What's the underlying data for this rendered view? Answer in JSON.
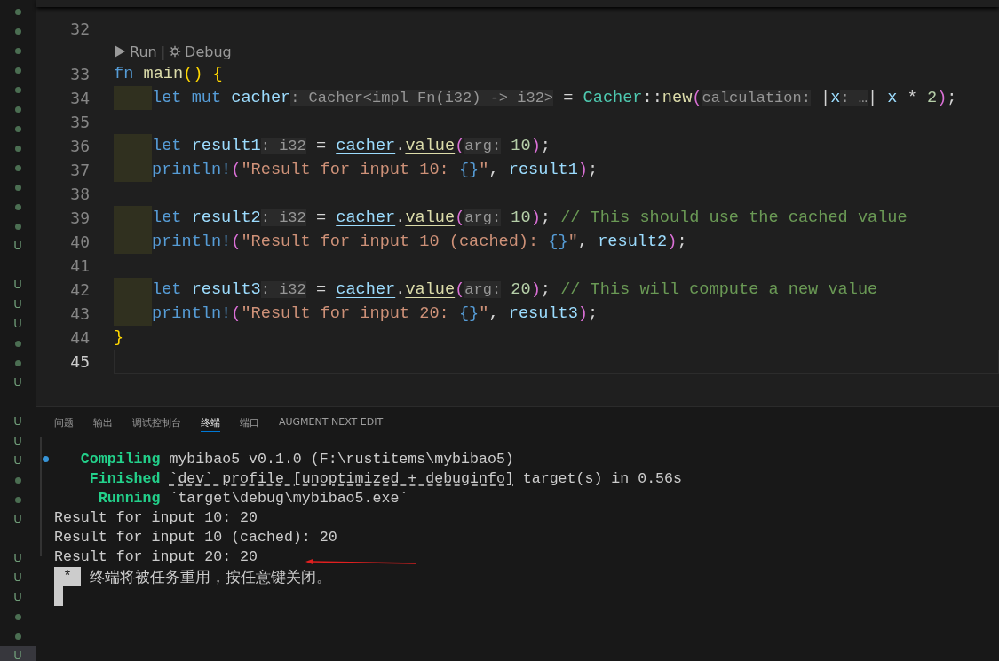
{
  "gutter_markers": [
    {
      "kind": "dot",
      "selected": false
    },
    {
      "kind": "dot",
      "selected": false
    },
    {
      "kind": "dot",
      "selected": false
    },
    {
      "kind": "dot",
      "selected": false
    },
    {
      "kind": "dot",
      "selected": false
    },
    {
      "kind": "dot",
      "selected": false
    },
    {
      "kind": "dot",
      "selected": false
    },
    {
      "kind": "dot",
      "selected": false
    },
    {
      "kind": "dot",
      "selected": false
    },
    {
      "kind": "dot",
      "selected": false
    },
    {
      "kind": "dot",
      "selected": false
    },
    {
      "kind": "dot",
      "selected": false
    },
    {
      "kind": "letter",
      "text": "U",
      "selected": false
    },
    {
      "kind": "gap",
      "selected": false
    },
    {
      "kind": "letter",
      "text": "U",
      "selected": false
    },
    {
      "kind": "letter",
      "text": "U",
      "selected": false
    },
    {
      "kind": "letter",
      "text": "U",
      "selected": false
    },
    {
      "kind": "dot",
      "selected": false
    },
    {
      "kind": "dot",
      "selected": false
    },
    {
      "kind": "letter",
      "text": "U",
      "selected": false
    },
    {
      "kind": "gap",
      "selected": false
    },
    {
      "kind": "letter",
      "text": "U",
      "selected": false
    },
    {
      "kind": "letter",
      "text": "U",
      "selected": false
    },
    {
      "kind": "letter",
      "text": "U",
      "selected": false
    },
    {
      "kind": "dot",
      "selected": false
    },
    {
      "kind": "dot",
      "selected": false
    },
    {
      "kind": "letter",
      "text": "U",
      "selected": false
    },
    {
      "kind": "gap",
      "selected": false
    },
    {
      "kind": "letter",
      "text": "U",
      "selected": false
    },
    {
      "kind": "letter",
      "text": "U",
      "selected": false
    },
    {
      "kind": "letter",
      "text": "U",
      "selected": false
    },
    {
      "kind": "dot",
      "selected": false
    },
    {
      "kind": "dot",
      "selected": false
    },
    {
      "kind": "letter",
      "text": "U",
      "selected": true
    }
  ],
  "editor": {
    "lines": [
      {
        "kind": "code",
        "number": "32",
        "indent": false,
        "current": false
      },
      {
        "kind": "codelens",
        "run": "Run",
        "separator": "|",
        "debug": "Debug"
      },
      {
        "kind": "code",
        "number": "33",
        "indent": false,
        "current": false,
        "tokens": [
          {
            "kind": "kw",
            "text": "fn "
          },
          {
            "kind": "fn",
            "text": "main"
          },
          {
            "kind": "bracket1",
            "text": "() {"
          }
        ]
      },
      {
        "kind": "code",
        "number": "34",
        "indent": true,
        "current": false,
        "tokens": [
          {
            "kind": "kw",
            "text": "let mut "
          },
          {
            "kind": "mutvar",
            "text": "cacher"
          },
          {
            "kind": "inlay",
            "text": ": Cacher<impl Fn(i32) -> i32>"
          },
          {
            "kind": "plain",
            "text": " = "
          },
          {
            "kind": "type",
            "text": "Cacher"
          },
          {
            "kind": "plain",
            "text": "::"
          },
          {
            "kind": "fn",
            "text": "new"
          },
          {
            "kind": "bracket2",
            "text": "("
          },
          {
            "kind": "inlay",
            "text": "calculation:"
          },
          {
            "kind": "plain",
            "text": " |"
          },
          {
            "kind": "var",
            "text": "x"
          },
          {
            "kind": "inlay",
            "text": ": …"
          },
          {
            "kind": "plain",
            "text": "| "
          },
          {
            "kind": "var",
            "text": "x"
          },
          {
            "kind": "plain",
            "text": " * "
          },
          {
            "kind": "num",
            "text": "2"
          },
          {
            "kind": "bracket2",
            "text": ")"
          },
          {
            "kind": "plain",
            "text": ";"
          }
        ]
      },
      {
        "kind": "code",
        "number": "35",
        "indent": false,
        "current": false
      },
      {
        "kind": "code",
        "number": "36",
        "indent": true,
        "current": false,
        "tokens": [
          {
            "kind": "kw",
            "text": "let "
          },
          {
            "kind": "var",
            "text": "result1"
          },
          {
            "kind": "inlay",
            "text": ": i32"
          },
          {
            "kind": "plain",
            "text": " = "
          },
          {
            "kind": "mutvar",
            "text": "cacher"
          },
          {
            "kind": "plain",
            "text": "."
          },
          {
            "kind": "mutfn",
            "text": "value"
          },
          {
            "kind": "bracket2",
            "text": "("
          },
          {
            "kind": "inlay",
            "text": "arg:"
          },
          {
            "kind": "num",
            "text": " 10"
          },
          {
            "kind": "bracket2",
            "text": ")"
          },
          {
            "kind": "plain",
            "text": ";"
          }
        ]
      },
      {
        "kind": "code",
        "number": "37",
        "indent": true,
        "current": false,
        "tokens": [
          {
            "kind": "macro",
            "text": "println!"
          },
          {
            "kind": "bracket2",
            "text": "("
          },
          {
            "kind": "str",
            "text": "\"Result for input 10: "
          },
          {
            "kind": "fmt",
            "text": "{}"
          },
          {
            "kind": "str",
            "text": "\""
          },
          {
            "kind": "plain",
            "text": ", "
          },
          {
            "kind": "var",
            "text": "result1"
          },
          {
            "kind": "bracket2",
            "text": ")"
          },
          {
            "kind": "plain",
            "text": ";"
          }
        ]
      },
      {
        "kind": "code",
        "number": "38",
        "indent": false,
        "current": false
      },
      {
        "kind": "code",
        "number": "39",
        "indent": true,
        "current": false,
        "tokens": [
          {
            "kind": "kw",
            "text": "let "
          },
          {
            "kind": "var",
            "text": "result2"
          },
          {
            "kind": "inlay",
            "text": ": i32"
          },
          {
            "kind": "plain",
            "text": " = "
          },
          {
            "kind": "mutvar",
            "text": "cacher"
          },
          {
            "kind": "plain",
            "text": "."
          },
          {
            "kind": "mutfn",
            "text": "value"
          },
          {
            "kind": "bracket2",
            "text": "("
          },
          {
            "kind": "inlay",
            "text": "arg:"
          },
          {
            "kind": "num",
            "text": " 10"
          },
          {
            "kind": "bracket2",
            "text": ")"
          },
          {
            "kind": "plain",
            "text": ";"
          },
          {
            "kind": "comment",
            "text": " // This should use the cached value"
          }
        ]
      },
      {
        "kind": "code",
        "number": "40",
        "indent": true,
        "current": false,
        "tokens": [
          {
            "kind": "macro",
            "text": "println!"
          },
          {
            "kind": "bracket2",
            "text": "("
          },
          {
            "kind": "str",
            "text": "\"Result for input 10 (cached): "
          },
          {
            "kind": "fmt",
            "text": "{}"
          },
          {
            "kind": "str",
            "text": "\""
          },
          {
            "kind": "plain",
            "text": ", "
          },
          {
            "kind": "var",
            "text": "result2"
          },
          {
            "kind": "bracket2",
            "text": ")"
          },
          {
            "kind": "plain",
            "text": ";"
          }
        ]
      },
      {
        "kind": "code",
        "number": "41",
        "indent": false,
        "current": false
      },
      {
        "kind": "code",
        "number": "42",
        "indent": true,
        "current": false,
        "tokens": [
          {
            "kind": "kw",
            "text": "let "
          },
          {
            "kind": "var",
            "text": "result3"
          },
          {
            "kind": "inlay",
            "text": ": i32"
          },
          {
            "kind": "plain",
            "text": " = "
          },
          {
            "kind": "mutvar",
            "text": "cacher"
          },
          {
            "kind": "plain",
            "text": "."
          },
          {
            "kind": "mutfn",
            "text": "value"
          },
          {
            "kind": "bracket2",
            "text": "("
          },
          {
            "kind": "inlay",
            "text": "arg:"
          },
          {
            "kind": "num",
            "text": " 20"
          },
          {
            "kind": "bracket2",
            "text": ")"
          },
          {
            "kind": "plain",
            "text": ";"
          },
          {
            "kind": "comment",
            "text": " // This will compute a new value"
          }
        ]
      },
      {
        "kind": "code",
        "number": "43",
        "indent": true,
        "current": false,
        "tokens": [
          {
            "kind": "macro",
            "text": "println!"
          },
          {
            "kind": "bracket2",
            "text": "("
          },
          {
            "kind": "str",
            "text": "\"Result for input 20: "
          },
          {
            "kind": "fmt",
            "text": "{}"
          },
          {
            "kind": "str",
            "text": "\""
          },
          {
            "kind": "plain",
            "text": ", "
          },
          {
            "kind": "var",
            "text": "result3"
          },
          {
            "kind": "bracket2",
            "text": ")"
          },
          {
            "kind": "plain",
            "text": ";"
          }
        ]
      },
      {
        "kind": "code",
        "number": "44",
        "indent": false,
        "current": false,
        "tokens": [
          {
            "kind": "bracket1",
            "text": "}"
          }
        ]
      },
      {
        "kind": "code",
        "number": "45",
        "indent": false,
        "current": true
      }
    ]
  },
  "panel": {
    "tabs": [
      {
        "label": "问题",
        "selected": false
      },
      {
        "label": "输出",
        "selected": false
      },
      {
        "label": "调试控制台",
        "selected": false
      },
      {
        "label": "终端",
        "selected": true
      },
      {
        "label": "端口",
        "selected": false
      },
      {
        "label": "AUGMENT NEXT EDIT",
        "selected": false
      }
    ],
    "terminal": {
      "output": [
        [
          {
            "kind": "status",
            "text": "Compiling"
          },
          {
            "kind": "plain",
            "text": "mybibao5 v0.1.0 (F:\\rustitems\\mybibao5)"
          }
        ],
        [
          {
            "kind": "status",
            "text": "Finished"
          },
          {
            "kind": "link",
            "text": "`dev` profile [unoptimized + debuginfo]"
          },
          {
            "kind": "plain",
            "text": " target(s) in 0.56s"
          }
        ],
        [
          {
            "kind": "status",
            "text": "Running"
          },
          {
            "kind": "plain",
            "text": "`target\\debug\\mybibao5.exe`"
          }
        ],
        [
          {
            "kind": "plain",
            "text": "Result for input 10: 20"
          }
        ],
        [
          {
            "kind": "plain",
            "text": "Result for input 10 (cached): 20"
          }
        ],
        [
          {
            "kind": "plain",
            "text": "Result for input 20: 20"
          }
        ]
      ],
      "task_mark": "*",
      "task_message": "终端将被任务重用，按任意键关闭。"
    }
  }
}
